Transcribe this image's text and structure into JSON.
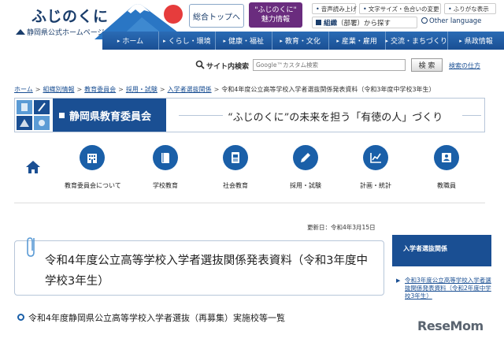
{
  "header": {
    "logo_title": "ふじのくに",
    "logo_sub": "静岡県公式ホームページ",
    "top_button": "総合トップへ",
    "miryoku_line1": "\"ふじのくに\"",
    "miryoku_line2": "魅力情報",
    "util_read": "音声読み上げ",
    "util_text": "文字サイズ・色合いの変更",
    "util_furigana": "ふりがな表示",
    "org_label": "組織",
    "org_rest": "（部署）から探す",
    "language": "Other language"
  },
  "nav": {
    "items": [
      "ホーム",
      "くらし・環境",
      "健康・福祉",
      "教育・文化",
      "産業・雇用",
      "交流・まちづくり",
      "県政情報"
    ]
  },
  "search": {
    "label": "サイト内検索",
    "placeholder": "Google™カスタム検索",
    "button": "検 索",
    "howto": "検索の仕方"
  },
  "breadcrumb": {
    "items": [
      "ホーム",
      "組織別情報",
      "教育委員会",
      "採用・試験",
      "入学者選抜関係"
    ],
    "current": "令和4年度公立高等学校入学者選抜関係発表資料（令和3年度中学校3年生）"
  },
  "board": {
    "title": "静岡県教育委員会",
    "slogan": "“ふじのくに”の未来を担う「有徳の人」づくり"
  },
  "categories": [
    {
      "label": "教育委員会について",
      "icon": "building-icon"
    },
    {
      "label": "学校教育",
      "icon": "book-icon"
    },
    {
      "label": "社会教育",
      "icon": "document-icon"
    },
    {
      "label": "採用・試験",
      "icon": "pencil-icon"
    },
    {
      "label": "計画・統計",
      "icon": "chart-icon"
    },
    {
      "label": "教職員",
      "icon": "person-icon"
    }
  ],
  "main": {
    "updated": "更新日：令和4年3月15日",
    "title": "令和4年度公立高等学校入学者選抜関係発表資料（令和3年度中学校3年生）",
    "section_heading": "令和4年度静岡県公立高等学校入学者選抜（再募集）実施校等一覧"
  },
  "side": {
    "heading": "入学者選抜関係",
    "link": "令和3年度公立高等学校入学者選抜関係発表資料（令和2年度中学校3年生）"
  },
  "watermark": "ReseMom",
  "colors": {
    "primary": "#1a4f93",
    "accent_purple": "#6a2c7e",
    "icon_blue": "#1a5fa8"
  }
}
